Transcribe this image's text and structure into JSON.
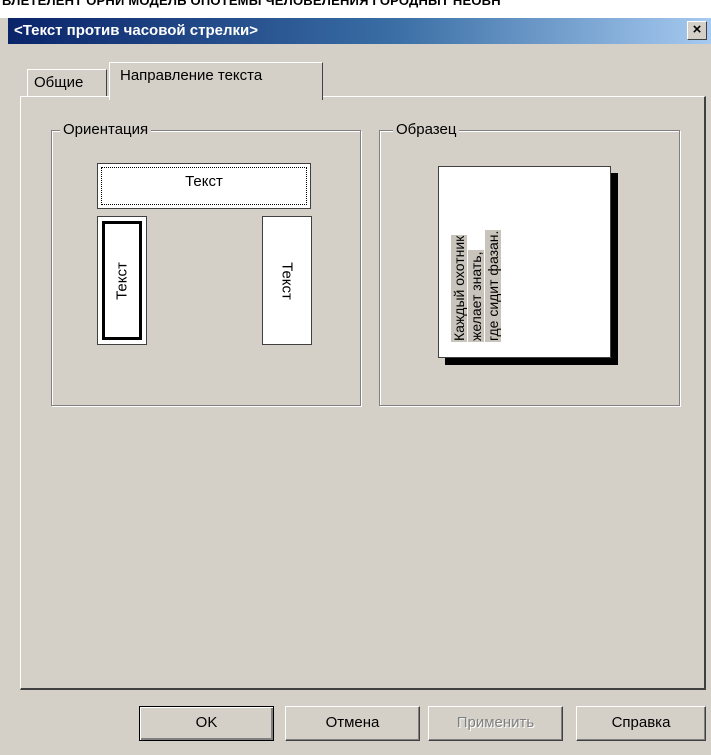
{
  "top_text": "ВЛЕТЕЛЕНТ ОРНИ МОДЕЛЬ ОПОТЕМЫ ЧЕЛОВЕЛЕНИЯ ГОРОДНЫТ НЕОВН",
  "window": {
    "title": "<Текст против часовой стрелки>",
    "close_label": "×"
  },
  "tabs": [
    {
      "label": "Общие",
      "active": false
    },
    {
      "label": "Направление текста",
      "active": true
    }
  ],
  "orientation": {
    "label": "Ориентация",
    "options": [
      {
        "label": "Текст",
        "direction": "horizontal"
      },
      {
        "label": "Текст",
        "direction": "counterclockwise",
        "selected": true
      },
      {
        "label": "Текст",
        "direction": "clockwise"
      }
    ]
  },
  "sample": {
    "label": "Образец",
    "lines": [
      "Каждый охотник",
      "желает знать,",
      "где сидит фазан."
    ]
  },
  "buttons": {
    "ok": "OK",
    "cancel": "Отмена",
    "apply": "Применить",
    "help": "Справка"
  }
}
